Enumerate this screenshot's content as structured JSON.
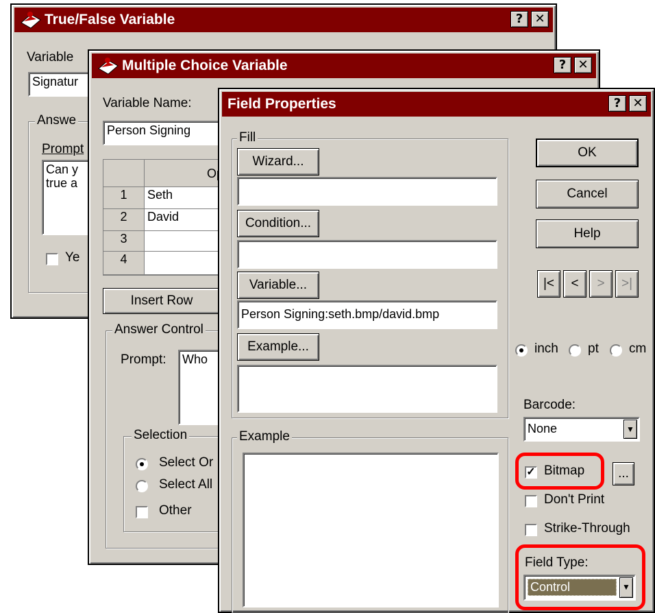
{
  "tf_window": {
    "title": "True/False Variable",
    "help_glyph": "?",
    "close_glyph": "✕",
    "variable_label": "Variable",
    "variable_value": "Signatur",
    "answer_group": "Answe",
    "prompt_label": "Prompt",
    "prompt_text": "Can y\ntrue a",
    "yes_checkbox_label": "Ye"
  },
  "mc_window": {
    "title": "Multiple Choice Variable",
    "help_glyph": "?",
    "close_glyph": "✕",
    "variable_name_label": "Variable Name:",
    "variable_name_value": "Person Signing",
    "grid_header": "Op",
    "rows": [
      {
        "num": "1",
        "value": "Seth"
      },
      {
        "num": "2",
        "value": "David"
      },
      {
        "num": "3",
        "value": ""
      },
      {
        "num": "4",
        "value": ""
      }
    ],
    "insert_row_label": "Insert Row",
    "answer_control_group": "Answer Control",
    "prompt_label": "Prompt:",
    "prompt_text": "Who",
    "selection_group": "Selection",
    "select_one_label": "Select Or",
    "select_all_label": "Select All",
    "other_label": "Other"
  },
  "fp_window": {
    "title": "Field Properties",
    "help_glyph": "?",
    "close_glyph": "✕",
    "fill_group": "Fill",
    "wizard_button": "Wizard...",
    "wizard_value": "",
    "condition_button": "Condition...",
    "condition_value": "",
    "variable_button": "Variable...",
    "variable_value": "Person Signing:seth.bmp/david.bmp",
    "example_button": "Example...",
    "example_value": "",
    "example_group": "Example",
    "ok_button": "OK",
    "cancel_button": "Cancel",
    "help_button": "Help",
    "nav_first": "|<",
    "nav_prev": "<",
    "nav_next": ">",
    "nav_last": ">|",
    "unit_inch": "inch",
    "unit_pt": "pt",
    "unit_cm": "cm",
    "barcode_label": "Barcode:",
    "barcode_value": "None",
    "bitmap_label": "Bitmap",
    "bitmap_browse": "...",
    "dont_print_label": "Don't Print",
    "strike_through_label": "Strike-Through",
    "field_type_label": "Field Type:",
    "field_type_value": "Control"
  },
  "colors": {
    "title_bar": "#800000",
    "dialog_face": "#d4d0c8",
    "highlight": "#ff0000"
  }
}
